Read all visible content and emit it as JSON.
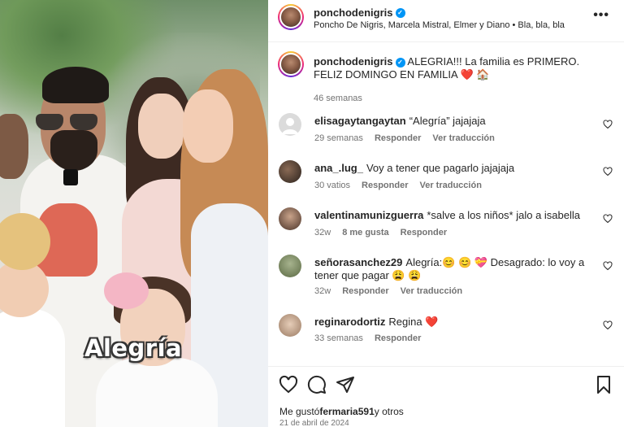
{
  "post": {
    "overlay_caption": "Alegría"
  },
  "header": {
    "username": "ponchodenigris",
    "subtitle": "Poncho De Nigris, Marcela Mistral, Elmer y Diano • Bla, bla, bla",
    "more_icon": "more-horizontal-icon"
  },
  "caption": {
    "username": "ponchodenigris",
    "text": "ALEGRIA!!! La familia es PRIMERO. FELIZ DOMINGO EN FAMILIA ❤️ 🏠",
    "time": "46 semanas"
  },
  "comments": [
    {
      "username": "elisagaytangaytan",
      "text": "“Alegría” jajajaja",
      "time": "29 semanas",
      "likes": "",
      "reply": "Responder",
      "translate": "Ver traducción"
    },
    {
      "username": "ana_.lug_",
      "text": "Voy a tener que pagarlo jajajaja",
      "time": "30 vatios",
      "likes": "",
      "reply": "Responder",
      "translate": "Ver traducción"
    },
    {
      "username": "valentinamunizguerra",
      "text": "*salve a los niños* jalo a isabella",
      "time": "32w",
      "likes": "8 me gusta",
      "reply": "Responder",
      "translate": ""
    },
    {
      "username": "señorasanchez29",
      "text": "Alegría:😊 😊 💝 Desagrado: lo voy a tener que pagar 😩 😩",
      "time": "32w",
      "likes": "",
      "reply": "Responder",
      "translate": "Ver traducción"
    },
    {
      "username": "reginarodortiz",
      "text": "Regina ❤️",
      "time": "33 semanas",
      "likes": "",
      "reply": "Responder",
      "translate": ""
    }
  ],
  "actions": {
    "like_icon": "heart-icon",
    "comment_icon": "comment-icon",
    "share_icon": "send-icon",
    "save_icon": "bookmark-icon",
    "likes_prefix": "Me gustó",
    "likes_user": "fermaria591",
    "likes_suffix": "y otros",
    "date": "21 de abril de 2024"
  },
  "colors": {
    "verified": "#0095f6",
    "meta_text": "#737373",
    "heart_red": "#ed4956"
  }
}
